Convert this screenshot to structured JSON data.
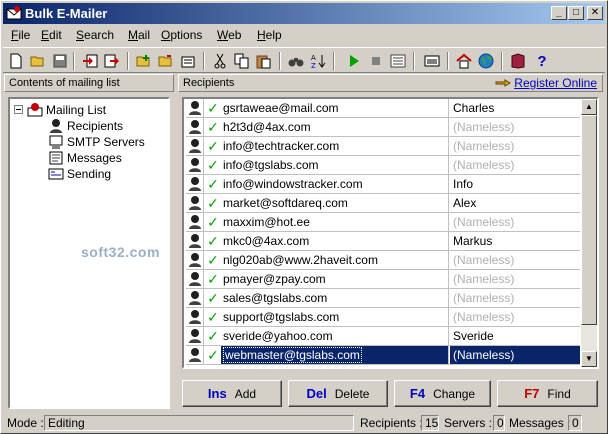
{
  "window": {
    "title": "Bulk E-Mailer"
  },
  "menu": [
    "File",
    "Edit",
    "Search",
    "Mail",
    "Options",
    "Web",
    "Help"
  ],
  "menu_underline": [
    "F",
    "E",
    "S",
    "M",
    "O",
    "W",
    "H"
  ],
  "left_panel": {
    "title": "Contents of mailing list"
  },
  "tree": {
    "root": "Mailing List",
    "children": [
      "Recipients",
      "SMTP Servers",
      "Messages",
      "Sending"
    ]
  },
  "watermark": "soft32.com",
  "right_panel": {
    "title": "Recipients",
    "register_link": "Register Online"
  },
  "recipients": [
    {
      "email": "gsrtaweae@mail.com",
      "name": "Charles"
    },
    {
      "email": "h2t3d@4ax.com",
      "name": "(Nameless)"
    },
    {
      "email": "info@techtracker.com",
      "name": "(Nameless)"
    },
    {
      "email": "info@tgslabs.com",
      "name": "(Nameless)"
    },
    {
      "email": "info@windowstracker.com",
      "name": "Info"
    },
    {
      "email": "market@softdareq.com",
      "name": "Alex"
    },
    {
      "email": "maxxim@hot.ee",
      "name": "(Nameless)"
    },
    {
      "email": "mkc0@4ax.com",
      "name": "Markus"
    },
    {
      "email": "nlg020ab@www.2haveit.com",
      "name": "(Nameless)"
    },
    {
      "email": "pmayer@zpay.com",
      "name": "(Nameless)"
    },
    {
      "email": "sales@tgslabs.com",
      "name": "(Nameless)"
    },
    {
      "email": "support@tgslabs.com",
      "name": "(Nameless)"
    },
    {
      "email": "sveride@yahoo.com",
      "name": "Sveride"
    },
    {
      "email": "webmaster@tgslabs.com",
      "name": "(Nameless)"
    }
  ],
  "selected_index": 13,
  "buttons": [
    {
      "key": "Ins",
      "label": "Add"
    },
    {
      "key": "Del",
      "label": "Delete"
    },
    {
      "key": "F4",
      "label": "Change"
    },
    {
      "key": "F7",
      "label": "Find"
    }
  ],
  "status": {
    "mode_label": "Mode :",
    "mode_value": "Editing",
    "recipients_label": "Recipients :",
    "recipients_value": "15",
    "servers_label": "Servers :",
    "servers_value": "0",
    "messages_label": "Messages :",
    "messages_value": "0"
  },
  "colors": {
    "accent": "#0a246a",
    "check": "#00a000",
    "key_blue": "#0000c0",
    "key_red": "#c00000"
  }
}
